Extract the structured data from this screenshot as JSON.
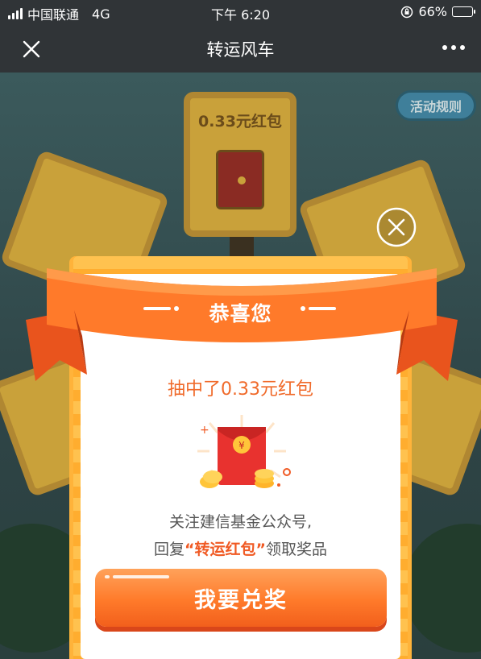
{
  "status_bar": {
    "carrier": "中国联通",
    "network": "4G",
    "time": "下午 6:20",
    "battery_percent": "66%",
    "battery_level": 0.66
  },
  "nav": {
    "title": "转运风车",
    "close_icon": "close-icon",
    "more_icon": "more-dots-icon"
  },
  "background": {
    "rules_button": "活动规则",
    "top_panel_text": "0.33元红包"
  },
  "dialog": {
    "ribbon_title": "恭喜您",
    "won_text": "抽中了0.33元红包",
    "desc_line1": "关注建信基金公众号,",
    "desc_line2_prefix": "回复",
    "desc_line2_highlight": "“转运红包”",
    "desc_line2_suffix": "领取奖品",
    "claim_button": "我要兑奖",
    "prize_icon": "red-envelope-icon",
    "close_icon": "circle-close-icon"
  },
  "colors": {
    "accent": "#f06a2a",
    "button": "#ff7a2a",
    "frame": "#ffb33a",
    "envelope": "#e8322f"
  }
}
